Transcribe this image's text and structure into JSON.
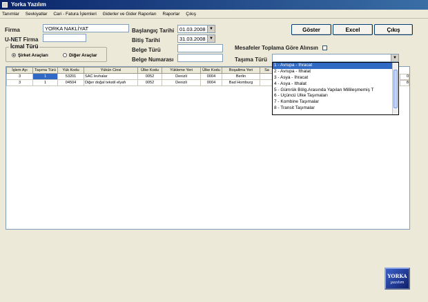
{
  "window": {
    "title": "Yorka Yazılım"
  },
  "menu": [
    "Tanımlar",
    "Sevkiyatlar",
    "Cari - Fatura İşlemleri",
    "Giderler ve Gider Raporları",
    "Raporlar",
    "Çıkış"
  ],
  "form": {
    "firma_label": "Firma",
    "firma_value": "YORKA NAKLİYAT",
    "unet_label": "U-NET Firma",
    "unet_value": "",
    "baslangic_label": "Başlangıç Tarihi",
    "baslangic_value": "01.03.2008",
    "bitis_label": "Bitiş Tarihi",
    "bitis_value": "31.03.2008",
    "belge_turu_label": "Belge Türü",
    "belge_turu_value": "",
    "belge_numarasi_label": "Belge Numarası",
    "belge_numarasi_value": "",
    "mesafe_label": "Mesafeler Toplama Göre Alınsın",
    "mesafe_checked": false,
    "tasima_label": "Taşıma Türü",
    "tasima_value": ""
  },
  "icmal": {
    "legend": "İcmal Türü",
    "option1": "Şirket Araçları",
    "option2": "Diğer Araçlar",
    "selected": "Şirket Araçları"
  },
  "buttons": {
    "goster": "Göster",
    "excel": "Excel",
    "cikis": "Çıkış"
  },
  "table": {
    "columns": [
      "İşlem Ayı",
      "Taşıma Türü",
      "Yük Kodu",
      "Yükün Cinsi",
      "Ülke Kodu",
      "Yükleme Yeri",
      "Ülke Kodu",
      "Boşaltma Yeri",
      "Sa"
    ],
    "rows": [
      [
        "3",
        "1",
        "53201",
        "SAC levhalar",
        "0052",
        "Denizli",
        "0004",
        "Berlin",
        ""
      ],
      [
        "3",
        "1",
        "04504",
        "Diğer doğal tekstil elyafı",
        "0052",
        "Denizli",
        "0004",
        "Bad Homburg",
        ""
      ]
    ],
    "partial_right": [
      "0",
      "8"
    ]
  },
  "dropdown_options": [
    "1 - Avrupa - İhracat",
    "2 - Avrupa - İthalat",
    "3 - Asya - İhracat",
    "4 - Asya - İthalat",
    "5 - Gümrük Bölg.Arasında Yapılan Millileşmemiş T",
    "6 - Üçüncü Ülke Taşımaları",
    "7 - Kombine Taşımalar",
    "8 - Transit Taşımalar"
  ],
  "logo": {
    "line1": "YORKA",
    "line2": "yazılım"
  },
  "colors": {
    "titlebar": "#0a246a",
    "selection": "#316ac5"
  }
}
